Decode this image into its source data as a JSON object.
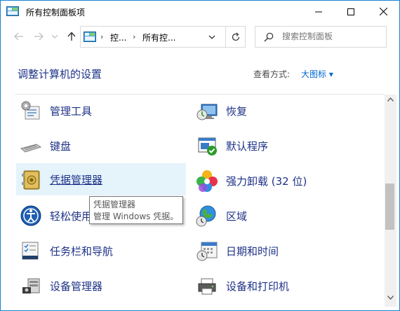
{
  "window": {
    "title": "所有控制面板项",
    "controls": {
      "minimize_icon": "minimize-icon",
      "maximize_icon": "maximize-icon",
      "close_icon": "close-icon"
    }
  },
  "navigation": {
    "back_icon": "back-arrow-icon",
    "forward_icon": "forward-arrow-icon",
    "recent_icon": "chevron-down-icon",
    "up_icon": "up-arrow-icon",
    "address": {
      "crumbs": [
        "控...",
        "所有控..."
      ],
      "separators": [
        "›",
        "›"
      ]
    },
    "refresh_icon": "refresh-icon",
    "search": {
      "placeholder": "搜索控制面板"
    }
  },
  "header": {
    "title": "调整计算机的设置",
    "view_by_label": "查看方式:",
    "view_by_value": "大图标 ▾"
  },
  "items": [
    {
      "label": "管理工具",
      "icon": "admin-tools-icon"
    },
    {
      "label": "恢复",
      "icon": "recovery-icon"
    },
    {
      "label": "键盘",
      "icon": "keyboard-icon"
    },
    {
      "label": "默认程序",
      "icon": "default-programs-icon"
    },
    {
      "label": "凭据管理器",
      "icon": "credential-manager-icon"
    },
    {
      "label": "强力卸载 (32 位)",
      "icon": "uninstaller-icon"
    },
    {
      "label": "轻松使用",
      "icon": "ease-of-access-icon"
    },
    {
      "label": "区域",
      "icon": "region-icon"
    },
    {
      "label": "任务栏和导航",
      "icon": "taskbar-icon"
    },
    {
      "label": "日期和时间",
      "icon": "date-time-icon"
    },
    {
      "label": "设备管理器",
      "icon": "device-manager-icon"
    },
    {
      "label": "设备和打印机",
      "icon": "devices-printers-icon"
    }
  ],
  "tooltip": {
    "title": "凭据管理器",
    "description": "管理 Windows 凭据。"
  },
  "colors": {
    "link": "#1e3287",
    "hover_bg": "#e5f3fb",
    "accent": "#0066cc",
    "border": "#1883d7"
  }
}
